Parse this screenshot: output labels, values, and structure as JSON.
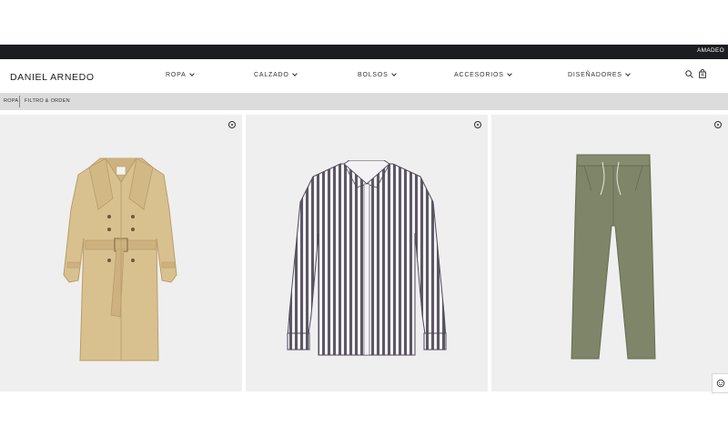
{
  "topbar": {
    "account_label": "AMADEO"
  },
  "header": {
    "logo": "DANIEL ARNEDO",
    "nav": [
      {
        "label": "ROPA"
      },
      {
        "label": "CALZADO"
      },
      {
        "label": "BOLSOS"
      },
      {
        "label": "ACCESORIOS"
      },
      {
        "label": "DISEÑADORES"
      }
    ],
    "icons": [
      "search-icon",
      "shopping-bag-icon"
    ]
  },
  "subbar": {
    "breadcrumb": "ROPA",
    "filter_label": "FILTRO & ORDEN"
  },
  "products": [
    {
      "icon": "favorite-icon",
      "image": "trench-coat",
      "color": "#d9c08f"
    },
    {
      "icon": "favorite-icon",
      "image": "striped-shirt",
      "color": "#6a6470"
    },
    {
      "icon": "favorite-icon",
      "image": "olive-trousers",
      "color": "#7e8568"
    }
  ],
  "widgets": {
    "chat_icon": "chat-icon"
  },
  "colors": {
    "topbar": "#1c1d20",
    "subbar": "#dcdcdc",
    "card": "#efefef"
  }
}
